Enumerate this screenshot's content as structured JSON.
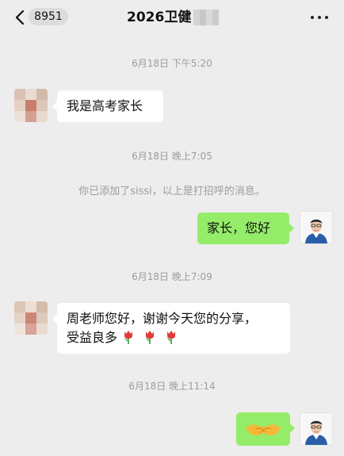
{
  "header": {
    "back_icon": "chevron-left-icon",
    "unread_count": "8951",
    "title": "2026卫健",
    "more_icon": "more-dots-icon"
  },
  "messages": [
    {
      "type": "time",
      "text": "6月18日 下午5:20"
    },
    {
      "type": "bubble",
      "side": "left",
      "text": "我是高考家长"
    },
    {
      "type": "time",
      "text": "6月18日 晚上7:05"
    },
    {
      "type": "system",
      "text": "你已添加了sissi，以上是打招呼的消息。"
    },
    {
      "type": "bubble",
      "side": "right",
      "text": "家长，您好"
    },
    {
      "type": "time",
      "text": "6月18日 晚上7:09"
    },
    {
      "type": "bubble",
      "side": "left",
      "text_line1": "周老师您好，谢谢今天您的分享，",
      "text_line2": "受益良多",
      "emoji": "tulip-icon"
    },
    {
      "type": "time",
      "text": "6月18日 晚上11:14"
    },
    {
      "type": "bubble",
      "side": "right",
      "emoji": "handshake-icon"
    }
  ],
  "colors": {
    "background": "#ededed",
    "bubble_left": "#ffffff",
    "bubble_right": "#95ec69",
    "timestamp": "#9c9c9c"
  }
}
